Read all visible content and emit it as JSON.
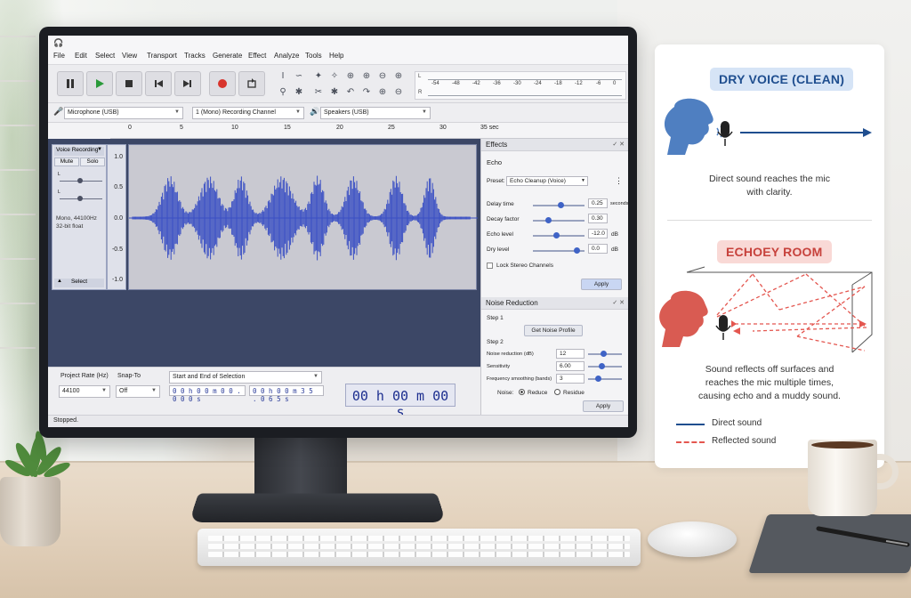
{
  "app": {
    "menu": [
      "File",
      "Edit",
      "Select",
      "View",
      "Transport",
      "Tracks",
      "Generate",
      "Effect",
      "Analyze",
      "Tools",
      "Help"
    ],
    "meter": {
      "channels": [
        "L",
        "R"
      ],
      "ticks": [
        "-54",
        "-48",
        "-42",
        "-36",
        "-30",
        "-24",
        "-18",
        "-12",
        "-6",
        "0"
      ]
    },
    "devices": {
      "input": "Microphone (USB)",
      "channels": "1 (Mono) Recording Channel",
      "output": "Speakers (USB)"
    },
    "ruler": {
      "ticks": [
        "0",
        "5",
        "10",
        "15",
        "20",
        "25",
        "30",
        "35 sec"
      ]
    },
    "track": {
      "name": "Voice Recording",
      "mute": "Mute",
      "solo": "Solo",
      "info_1": "Mono, 44100Hz",
      "info_2": "32-bit float",
      "select": "Select",
      "scale": [
        "1.0",
        "0.5",
        "0.0",
        "-0.5",
        "-1.0"
      ]
    },
    "effects": {
      "title": "Effects",
      "effect_name": "Echo",
      "preset_label": "Preset:",
      "preset_value": "Echo Cleanup (Voice)",
      "params": [
        {
          "label": "Delay time",
          "value": "0.25",
          "unit": "seconds",
          "level": 0.55
        },
        {
          "label": "Decay factor",
          "value": "0.30",
          "unit": "",
          "level": 0.3
        },
        {
          "label": "Echo level",
          "value": "-12.0",
          "unit": "dB",
          "level": 0.45
        },
        {
          "label": "Dry level",
          "value": "0.0",
          "unit": "dB",
          "level": 0.85
        }
      ],
      "lock_label": "Lock Stereo Channels",
      "apply": "Apply"
    },
    "noise": {
      "title": "Noise Reduction",
      "step1": "Step 1",
      "get_profile": "Get Noise Profile",
      "step2": "Step 2",
      "params": [
        {
          "label": "Noise reduction (dB)",
          "value": "12",
          "level": 0.45
        },
        {
          "label": "Sensitivity",
          "value": "6.00",
          "level": 0.4
        },
        {
          "label": "Frequency smoothing (bands)",
          "value": "3",
          "level": 0.3
        }
      ],
      "noise_label": "Noise:",
      "reduce": "Reduce",
      "residue": "Residue",
      "apply": "Apply"
    },
    "selection_bar": {
      "rate_label": "Project Rate (Hz)",
      "rate_value": "44100",
      "snap_label": "Snap-To",
      "snap_value": "Off",
      "sel_mode": "Start and End of Selection",
      "start": "0 0 h 0 0 m 0 0 . 0 0 0 s",
      "end": "0 0 h 0 0 m 3 5 . 0 6 5 s",
      "position": "00 h 00 m 00 s"
    },
    "status": "Stopped."
  },
  "card": {
    "dry_title": "DRY VOICE (CLEAN)",
    "dry_text_1": "Direct sound reaches the mic",
    "dry_text_2": "with clarity.",
    "echo_title": "ECHOEY ROOM",
    "echo_text_1": "Sound reflects off surfaces and",
    "echo_text_2": "reaches the mic multiple times,",
    "echo_text_3": "causing echo and a muddy sound.",
    "legend_direct": "Direct sound",
    "legend_reflected": "Reflected sound",
    "colors": {
      "blue": "#1f4e8f",
      "red": "#e4564f",
      "pill_blue_bg": "#d6e4f6",
      "pill_red_bg": "#f9d9d6"
    }
  }
}
